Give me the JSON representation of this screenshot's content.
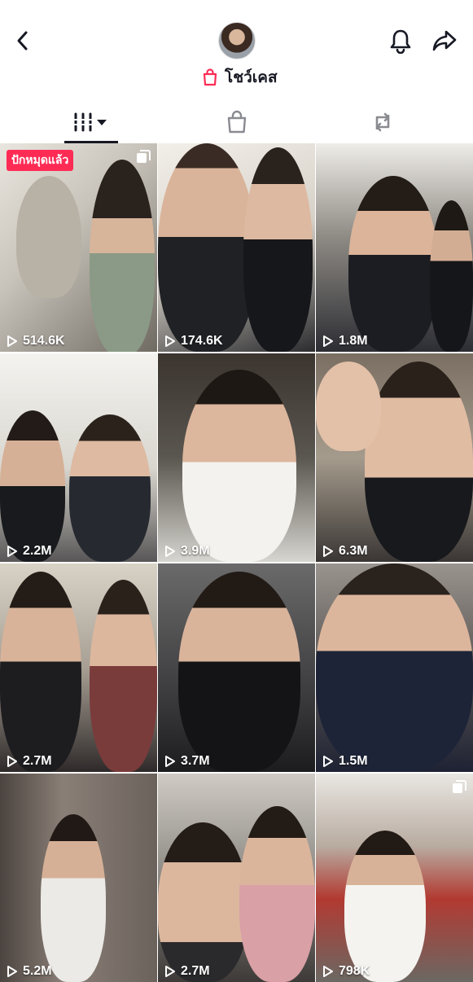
{
  "header": {
    "showcase_label": "โชว์เคส"
  },
  "videos": [
    {
      "views": "514.6K",
      "badge": "ปักหมุดแล้ว",
      "multi": true
    },
    {
      "views": "174.6K"
    },
    {
      "views": "1.8M"
    },
    {
      "views": "2.2M"
    },
    {
      "views": "3.9M"
    },
    {
      "views": "6.3M"
    },
    {
      "views": "2.7M"
    },
    {
      "views": "3.7M"
    },
    {
      "views": "1.5M"
    },
    {
      "views": "5.2M"
    },
    {
      "views": "2.7M"
    },
    {
      "views": "798K",
      "multi": true
    }
  ],
  "colors": {
    "accent": "#fe2c55",
    "text": "#161823",
    "muted": "#8a8b91"
  }
}
